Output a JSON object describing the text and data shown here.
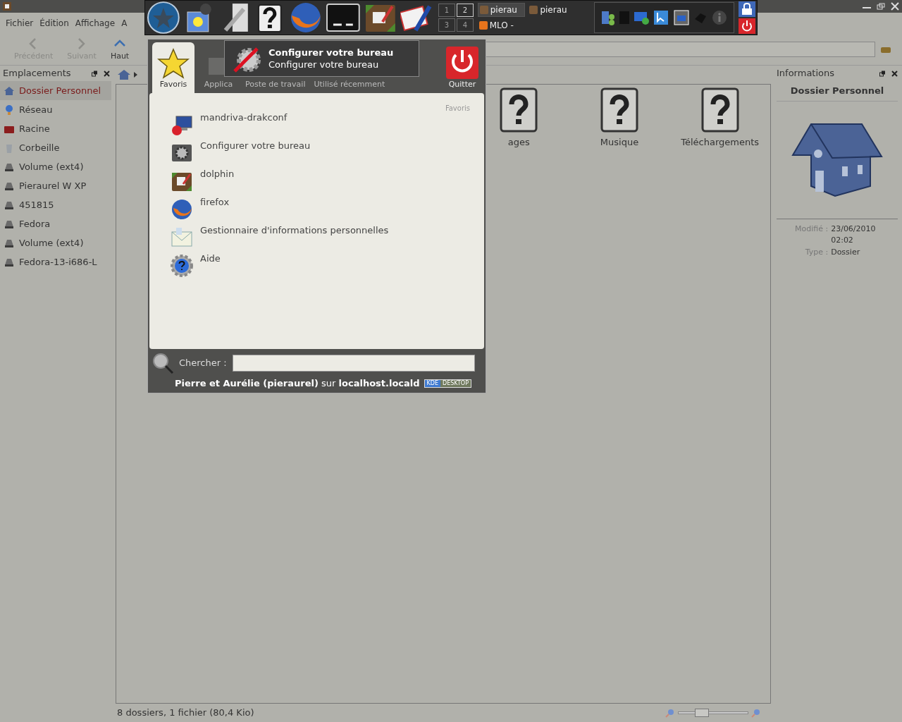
{
  "menu": [
    "Fichier",
    "Édition",
    "Affichage",
    "A"
  ],
  "toolbar": [
    {
      "label": "Précédent",
      "disabled": true,
      "kind": "back"
    },
    {
      "label": "Suivant",
      "disabled": true,
      "kind": "forward"
    },
    {
      "label": "Haut",
      "disabled": false,
      "kind": "up"
    }
  ],
  "places": {
    "title": "Emplacements",
    "items": [
      {
        "label": "Dossier Personnel",
        "selected": true,
        "kind": "home"
      },
      {
        "label": "Réseau",
        "selected": false,
        "kind": "network"
      },
      {
        "label": "Racine",
        "selected": false,
        "kind": "root"
      },
      {
        "label": "Corbeille",
        "selected": false,
        "kind": "trash"
      },
      {
        "label": "Volume (ext4)",
        "selected": false,
        "kind": "drive"
      },
      {
        "label": "Pieraurel W XP",
        "selected": false,
        "kind": "drive"
      },
      {
        "label": "451815",
        "selected": false,
        "kind": "drive"
      },
      {
        "label": "Fedora",
        "selected": false,
        "kind": "drive"
      },
      {
        "label": "Volume (ext4)",
        "selected": false,
        "kind": "drive"
      },
      {
        "label": "Fedora-13-i686-L",
        "selected": false,
        "kind": "drive"
      }
    ]
  },
  "view": {
    "items": [
      "ages",
      "Musique",
      "Téléchargements"
    ]
  },
  "info": {
    "title": "Informations",
    "name": "Dossier Personnel",
    "fields": [
      {
        "label": "Modifié :",
        "value": "23/06/2010 02:02"
      },
      {
        "label": "Type :",
        "value": "Dossier"
      }
    ]
  },
  "status_bar": {
    "text": "8 dossiers, 1 fichier (80,4 Kio)",
    "zoom": {
      "level": 0.3
    }
  },
  "panel": {
    "pager": [
      {
        "label": "1",
        "selected": false
      },
      {
        "label": "2",
        "selected": true
      },
      {
        "label": "3",
        "selected": false
      },
      {
        "label": "4",
        "selected": false
      }
    ],
    "tasks": [
      {
        "label": "pierau",
        "selected": true
      },
      {
        "label": "pierau",
        "selected": false
      },
      {
        "label": "MLO -",
        "selected": false
      }
    ]
  },
  "kickoff": {
    "tabs": [
      {
        "label": "Favoris",
        "selected": true
      },
      {
        "label": "Applica",
        "selected": false
      },
      {
        "label": "Poste de travail",
        "selected": false
      },
      {
        "label": "Utilisé récemment",
        "selected": false
      }
    ],
    "quit": "Quitter",
    "section": "Favoris",
    "items": [
      {
        "label": "mandriva-drakconf",
        "kind": "computer"
      },
      {
        "label": "Configurer votre bureau",
        "kind": "settings"
      },
      {
        "label": "dolphin",
        "kind": "files"
      },
      {
        "label": "firefox",
        "kind": "browser"
      },
      {
        "label": "Gestionnaire d'informations personnelles",
        "kind": "mail"
      },
      {
        "label": "Aide",
        "kind": "help"
      }
    ],
    "search_label": "Chercher :",
    "user_line": "**Pierre et Aurélie (pieraurel)** sur **localhost.locald**",
    "badge": [
      "KDE",
      "DESKTOP"
    ]
  },
  "tooltip": {
    "title": "Configurer votre bureau",
    "subtitle": "Configurer votre bureau"
  }
}
